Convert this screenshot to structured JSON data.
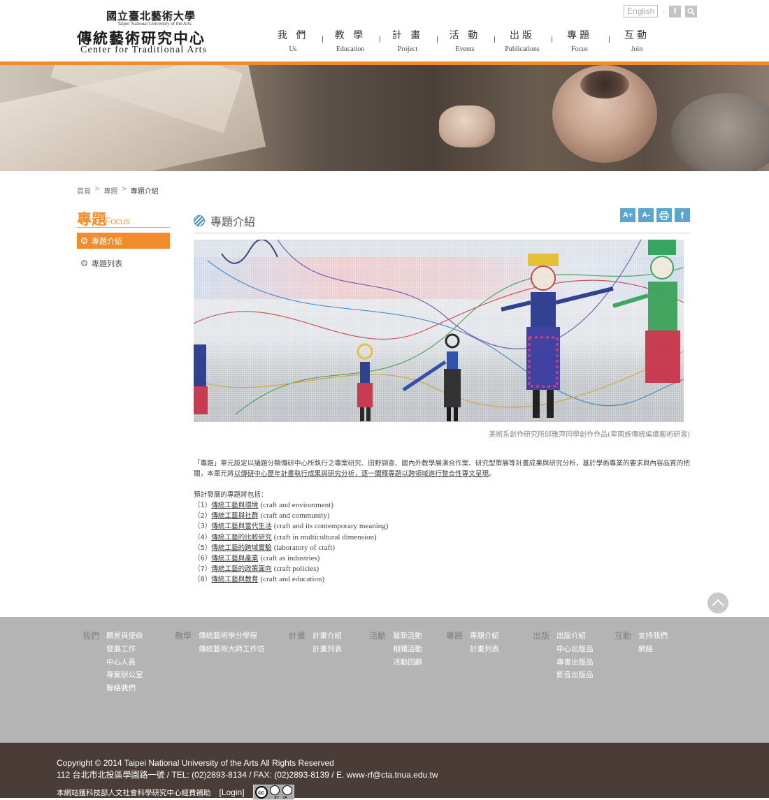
{
  "header": {
    "university_zh": "國立臺北藝術大學",
    "university_en": "Taipei National University of the Arts",
    "center_zh": "傳統藝術研究中心",
    "center_en": "Center for Traditional Arts",
    "lang_button": "English",
    "facebook_glyph": "f",
    "nav": [
      {
        "zh": "我 們",
        "en": "Us"
      },
      {
        "zh": "教 學",
        "en": "Education"
      },
      {
        "zh": "計 畫",
        "en": "Project"
      },
      {
        "zh": "活 動",
        "en": "Events"
      },
      {
        "zh": "出版",
        "en": "Publications"
      },
      {
        "zh": "專題",
        "en": "Focus"
      },
      {
        "zh": "互動",
        "en": "Join"
      }
    ]
  },
  "breadcrumb": {
    "home": "首頁",
    "level1": "專題",
    "current": "專題介紹",
    "sep": ">"
  },
  "sidebar": {
    "title_zh": "專題",
    "title_en": "Focus",
    "items": [
      {
        "label": "專題介紹"
      },
      {
        "label": "專題列表"
      }
    ]
  },
  "main": {
    "title": "專題介紹",
    "tools": {
      "font_larger": "A+",
      "font_smaller": "A-",
      "print_icon": "print-icon",
      "facebook": "f"
    },
    "photo_caption": "美術系創作研究所邱雅萍同學創作作品(卑南族傳統編織藝術研習)",
    "intro_part1": "「專題」單元設定以議題分類傳研中心所執行之專案研究、田野調查、國內外教學展演合作案、研究型策展等計畫成果與研究分析，基於學術專業的要求與內容品質的把關，本單元將",
    "intro_part2": "以傳研中心歷年計畫執行成果與研究分析，逐一闡釋專題以跨領域進行整合性專文呈現",
    "intro_part3": "。",
    "list_label": "預計發展的專題將包括：",
    "topics": [
      {
        "num": "（1）",
        "zh": "傳統工藝與環境",
        "en": "(craft and environment)"
      },
      {
        "num": "（2）",
        "zh": "傳統工藝與社群",
        "en": "(craft and community)"
      },
      {
        "num": "（3）",
        "zh": "傳統工藝與當代生活",
        "en": "(craft and its contemporary meaning)"
      },
      {
        "num": "（4）",
        "zh": "傳統工藝的比較研究",
        "en": "(craft in multicultural dimension)"
      },
      {
        "num": "（5）",
        "zh": "傳統工藝的跨域實驗",
        "en": "(laboratory of craft)"
      },
      {
        "num": "（6）",
        "zh": "傳統工藝與產業",
        "en": "(craft as industries)"
      },
      {
        "num": "（7）",
        "zh": "傳統工藝的政策面向",
        "en": "(craft policies)"
      },
      {
        "num": "（8）",
        "zh": "傳統工藝與教育",
        "en": "(craft and education)"
      }
    ]
  },
  "footer_nav": [
    {
      "head": "我們",
      "links": [
        "願景與使命",
        "發展工作",
        "中心人員",
        "專案辦公室",
        "聯絡我們"
      ]
    },
    {
      "head": "教學",
      "links": [
        "傳統藝術學分學程",
        "傳統藝術大師工作坊"
      ]
    },
    {
      "head": "計畫",
      "links": [
        "計畫介紹",
        "計畫列表"
      ]
    },
    {
      "head": "活動",
      "links": [
        "最新活動",
        "相關活動",
        "活動回顧"
      ]
    },
    {
      "head": "專題",
      "links": [
        "專題介紹",
        "計畫列表"
      ]
    },
    {
      "head": "出版",
      "links": [
        "出版介紹",
        "中心出版品",
        "專書出版品",
        "影音出版品"
      ]
    },
    {
      "head": "互動",
      "links": [
        "支持我們",
        "網絡"
      ]
    }
  ],
  "footer": {
    "copyright": "Copyright © 2014 Taipei National University of the Arts All Rights Reserved",
    "address": "112 台北市北投區學園路一號 / TEL: (02)2893-8134 / FAX: (02)2893-8139 / E. www-rf@cta.tnua.edu.tw",
    "funding": "本網站獲科技部人文社會科學研究中心經費補助",
    "login": "[Login]",
    "cc_cc": "cc",
    "cc_by": "BY",
    "cc_sa": "SA"
  },
  "colors": {
    "accent_orange": "#f08c2a",
    "tool_blue": "#5ba6cf",
    "footer_gray": "#b4b4b4",
    "footer_brown": "#4a3c36"
  }
}
